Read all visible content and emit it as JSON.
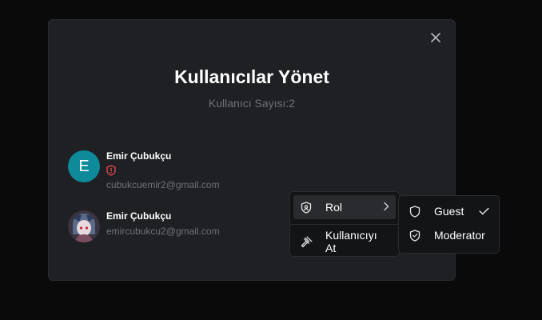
{
  "modal": {
    "title": "Kullanıcılar Yönet",
    "subtitle": "Kullanıcı Sayısı:2",
    "close_icon": "close-icon"
  },
  "users": [
    {
      "name": "Emir Çubukçu",
      "email": "cubukcuemir2@gmail.com",
      "avatar_letter": "E",
      "avatar_color": "#0e8a9b",
      "badge_icon": "shield-alert-icon",
      "badge_color": "#e5484d"
    },
    {
      "name": "Emir Çubukçu",
      "email": "emircubukcu2@gmail.com",
      "avatar_icon": "profile-photo"
    }
  ],
  "context_menu": {
    "items": [
      {
        "label": "Rol",
        "icon": "shield-icon",
        "has_submenu": true
      },
      {
        "label": "Kullanıcıyı At",
        "icon": "gavel-icon"
      }
    ]
  },
  "role_submenu": {
    "items": [
      {
        "label": "Guest",
        "icon": "shield-icon",
        "selected": true
      },
      {
        "label": "Moderator",
        "icon": "shield-check-icon",
        "selected": false
      }
    ]
  }
}
